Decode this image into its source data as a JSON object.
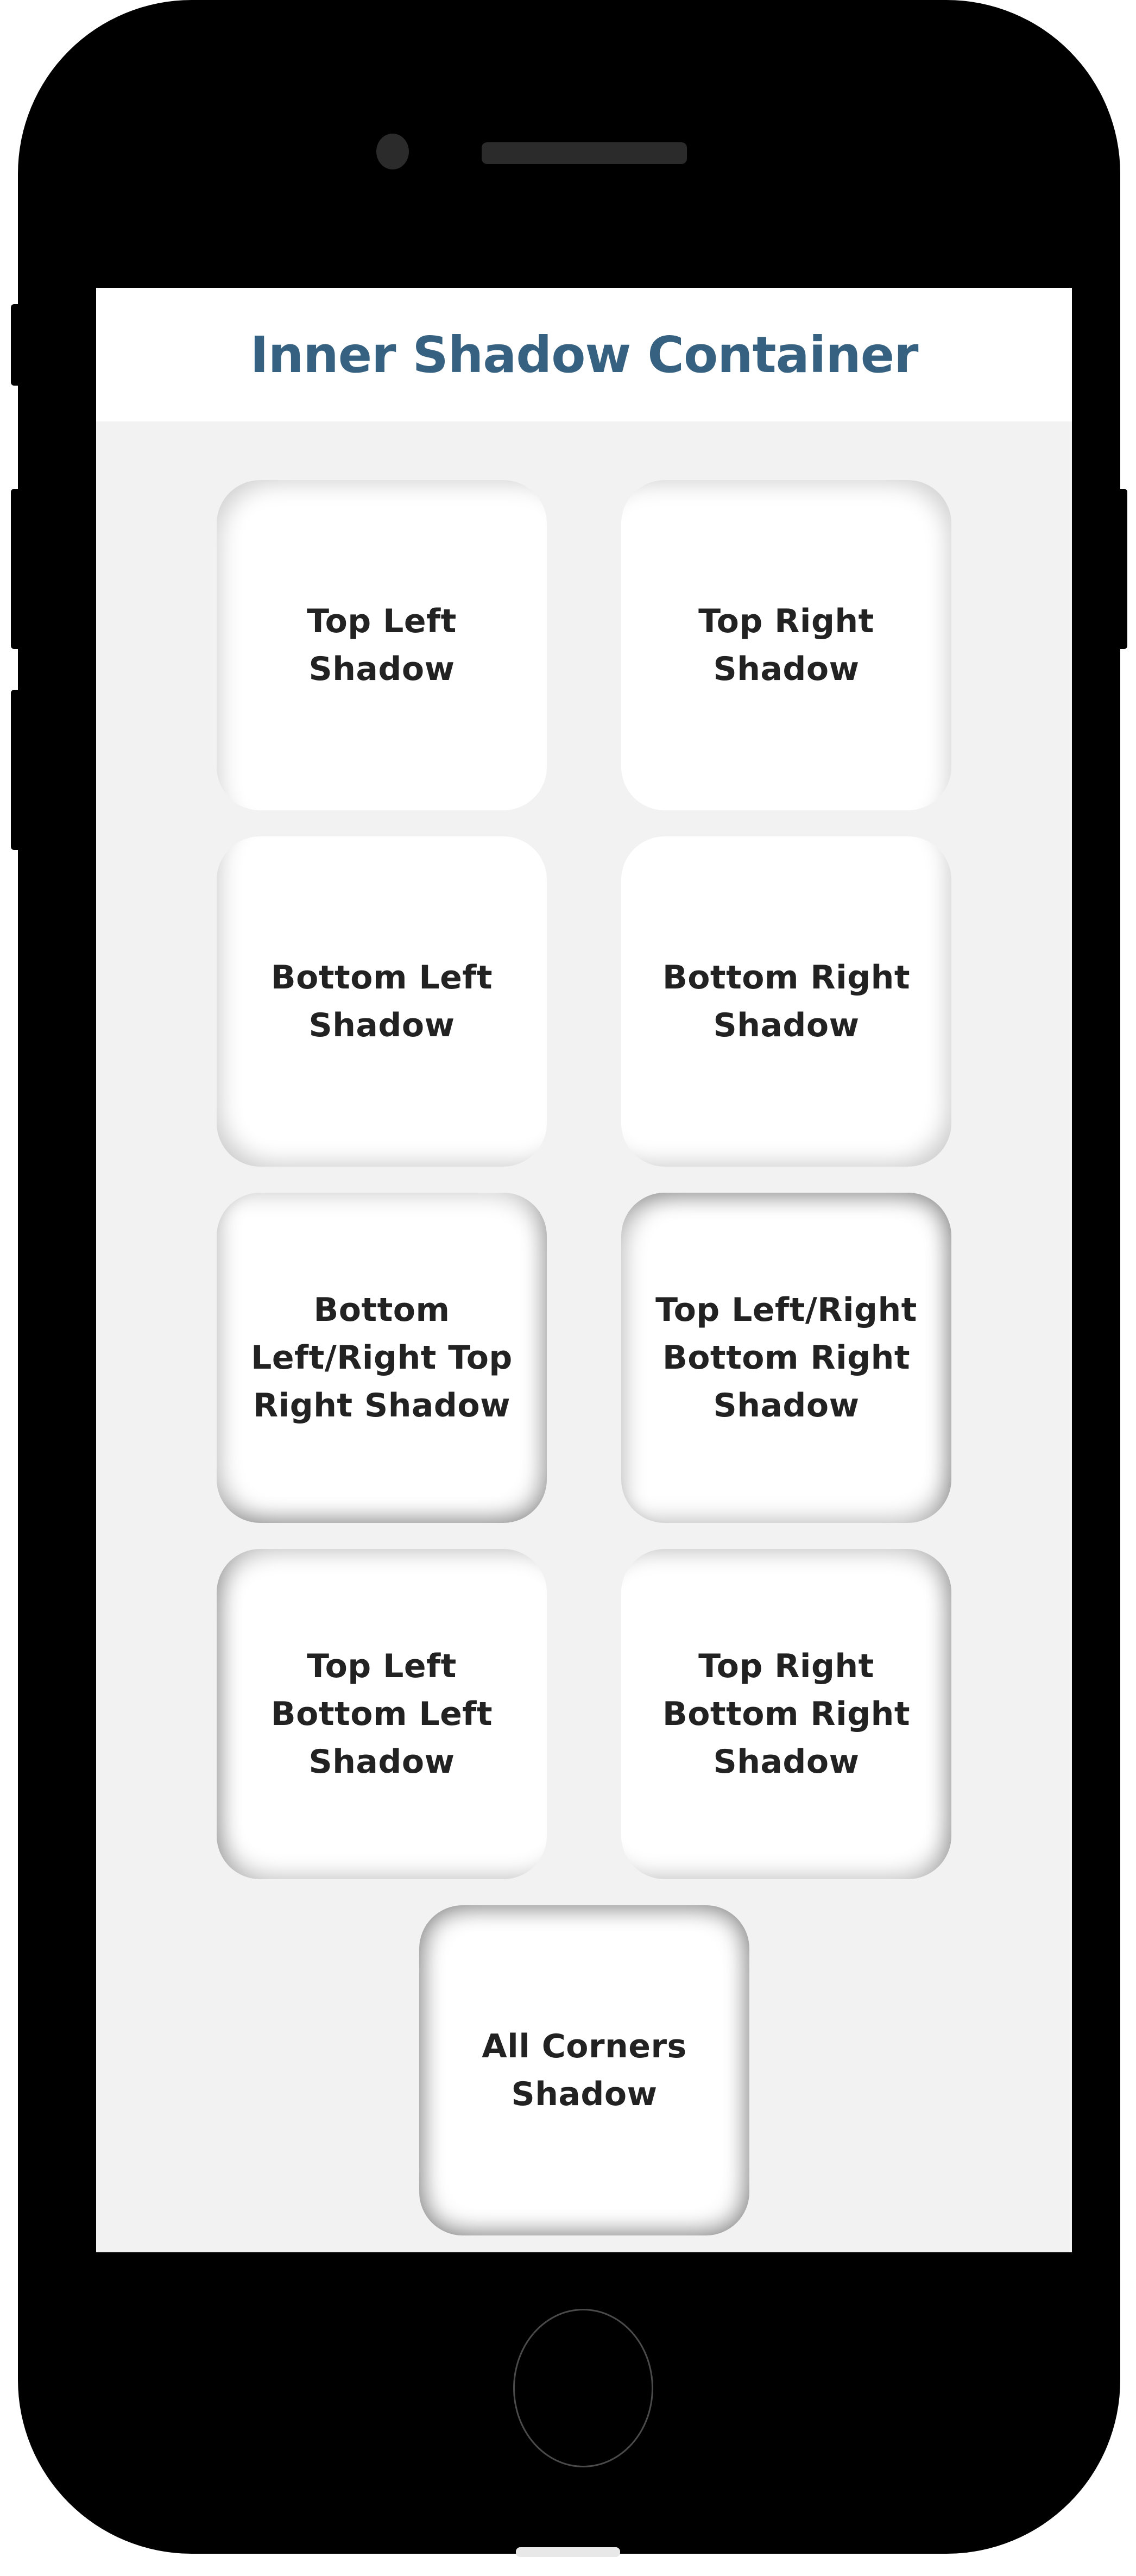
{
  "header": {
    "title": "Inner Shadow Container"
  },
  "cards": {
    "top_left": "Top Left Shadow",
    "top_right": "Top Right Shadow",
    "bottom_left": "Bottom Left Shadow",
    "bottom_right": "Bottom Right Shadow",
    "bottom_lr_top_right": "Bottom Left/Right Top Right Shadow",
    "top_lr_bottom_right": "Top Left/Right Bottom Right Shadow",
    "top_left_bottom_left": "Top Left Bottom Left Shadow",
    "top_right_bottom_right": "Top Right Bottom Right Shadow",
    "all_corners": "All Corners Shadow"
  },
  "colors": {
    "title": "#366180",
    "screen_background": "#f2f2f2",
    "card_background": "#ffffff",
    "card_text": "#222222",
    "phone_body": "#000000"
  },
  "icons": {
    "camera": "camera-icon",
    "speaker": "speaker-grille",
    "home": "home-button"
  }
}
